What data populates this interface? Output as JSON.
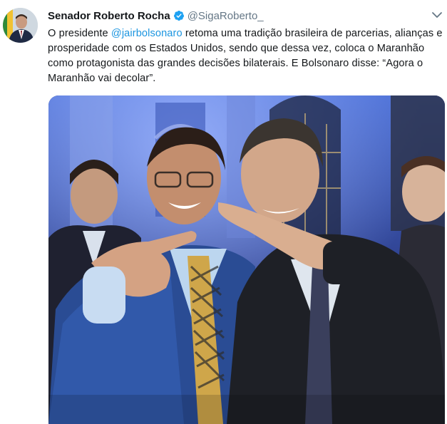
{
  "tweet": {
    "author_name": "Senador Roberto Rocha",
    "handle": "@SigaRoberto_",
    "verified_icon": "verified-badge-icon",
    "menu_icon": "chevron-down-icon",
    "text_before": "O presidente ",
    "mention": "@jairbolsonaro",
    "text_after": " retoma uma tradição brasileira de parcerias, alianças e prosperidade com os Estados Unidos, sendo que dessa vez, coloca o Maranhão como protagonista das grandes decisões bilaterais. E Bolsonaro disse: “Agora o Maranhão vai decolar”.",
    "media_type": "photo"
  },
  "colors": {
    "link": "#1b95e0",
    "verified": "#1da1f2",
    "secondary_text": "#657786",
    "primary_text": "#14171a"
  }
}
